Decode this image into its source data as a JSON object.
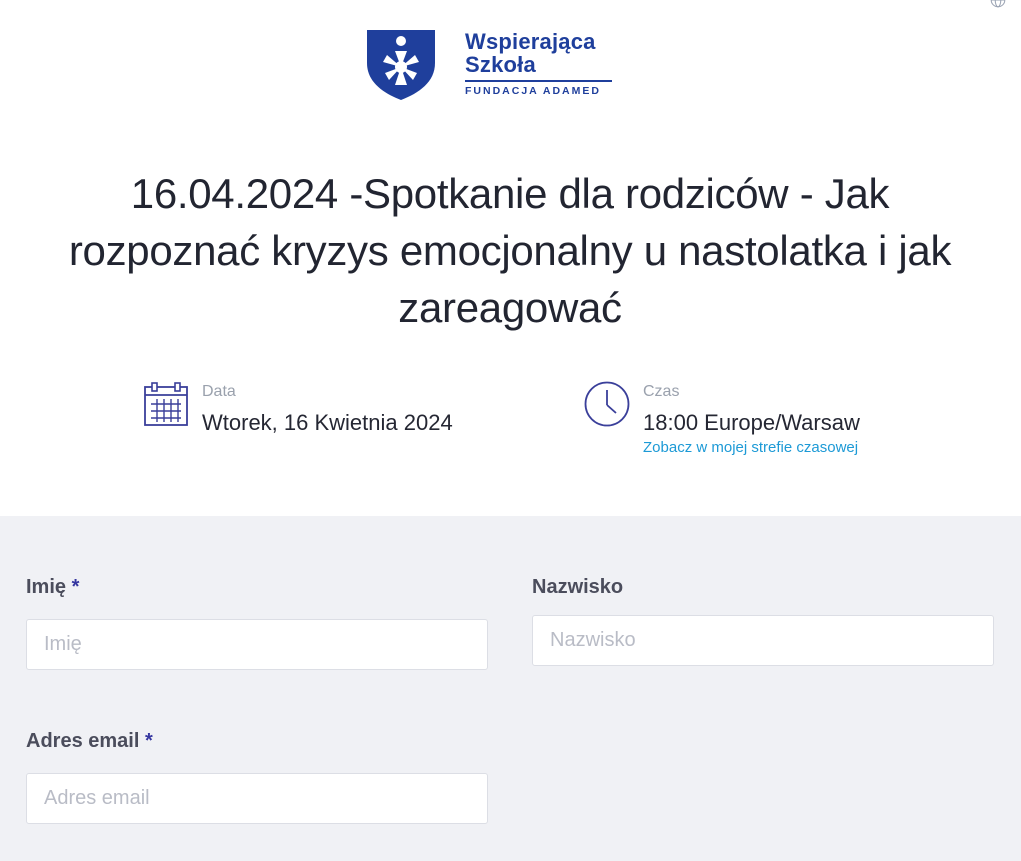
{
  "logo": {
    "line1": "Wspierająca",
    "line2": "Szkoła",
    "subtitle": "FUNDACJA ADAMED",
    "brand_color": "#1f3f9c"
  },
  "event": {
    "title": "16.04.2024 -Spotkanie dla rodziców - Jak rozpoznać kryzys emocjonalny u nastolatka i jak zareagować"
  },
  "date": {
    "icon": "calendar-icon",
    "label": "Data",
    "value": "Wtorek, 16 Kwietnia 2024"
  },
  "time": {
    "icon": "clock-icon",
    "label": "Czas",
    "value": "18:00 Europe/Warsaw",
    "timezone_link": "Zobacz w mojej strefie czasowej"
  },
  "form": {
    "first_name": {
      "label": "Imię",
      "required_mark": "*",
      "placeholder": "Imię",
      "value": ""
    },
    "last_name": {
      "label": "Nazwisko",
      "placeholder": "Nazwisko",
      "value": ""
    },
    "email": {
      "label": "Adres email",
      "required_mark": "*",
      "placeholder": "Adres email",
      "value": ""
    }
  },
  "colors": {
    "accent": "#3536a0",
    "link": "#1d9ad6",
    "form_background": "#f0f1f5"
  }
}
